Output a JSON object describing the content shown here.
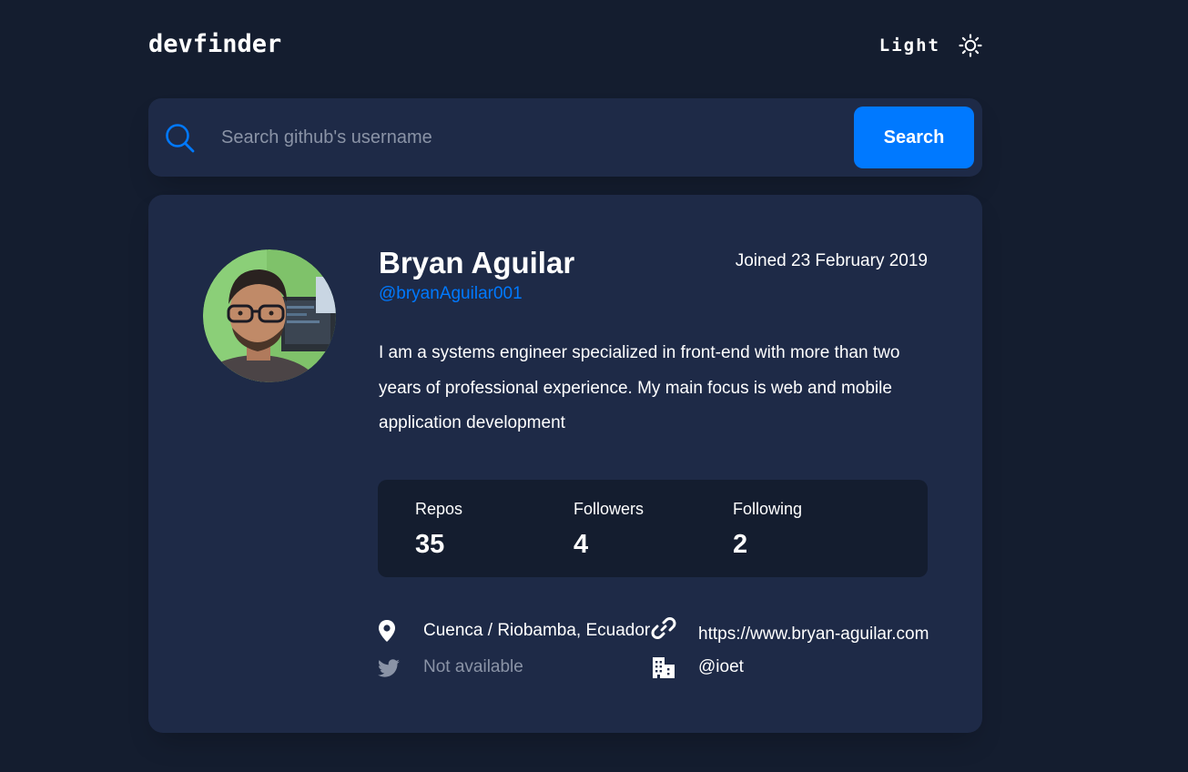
{
  "header": {
    "logo": "devfinder",
    "theme_label": "Light",
    "theme_icon": "sun-icon"
  },
  "search": {
    "placeholder": "Search github's username",
    "value": "",
    "button_label": "Search",
    "icon": "search-icon"
  },
  "profile": {
    "name": "Bryan Aguilar",
    "login": "@bryanAguilar001",
    "joined": "Joined 23 February 2019",
    "bio": "I am a systems engineer specialized in front-end with more than two years of professional experience. My main focus is web and mobile application development",
    "stats": [
      {
        "label": "Repos",
        "value": "35"
      },
      {
        "label": "Followers",
        "value": "4"
      },
      {
        "label": "Following",
        "value": "2"
      }
    ],
    "links": {
      "location": {
        "icon": "location-pin-icon",
        "text": "Cuenca / Riobamba, Ecuador"
      },
      "website": {
        "icon": "link-icon",
        "text": "https://www.bryan-aguilar.com"
      },
      "twitter": {
        "icon": "twitter-icon",
        "text": "Not available"
      },
      "company": {
        "icon": "building-icon",
        "text": "@ioet"
      }
    }
  },
  "colors": {
    "background": "#141d2f",
    "card": "#1e2a47",
    "accent": "#0079ff",
    "muted": "#8a93a6",
    "text": "#ffffff"
  }
}
